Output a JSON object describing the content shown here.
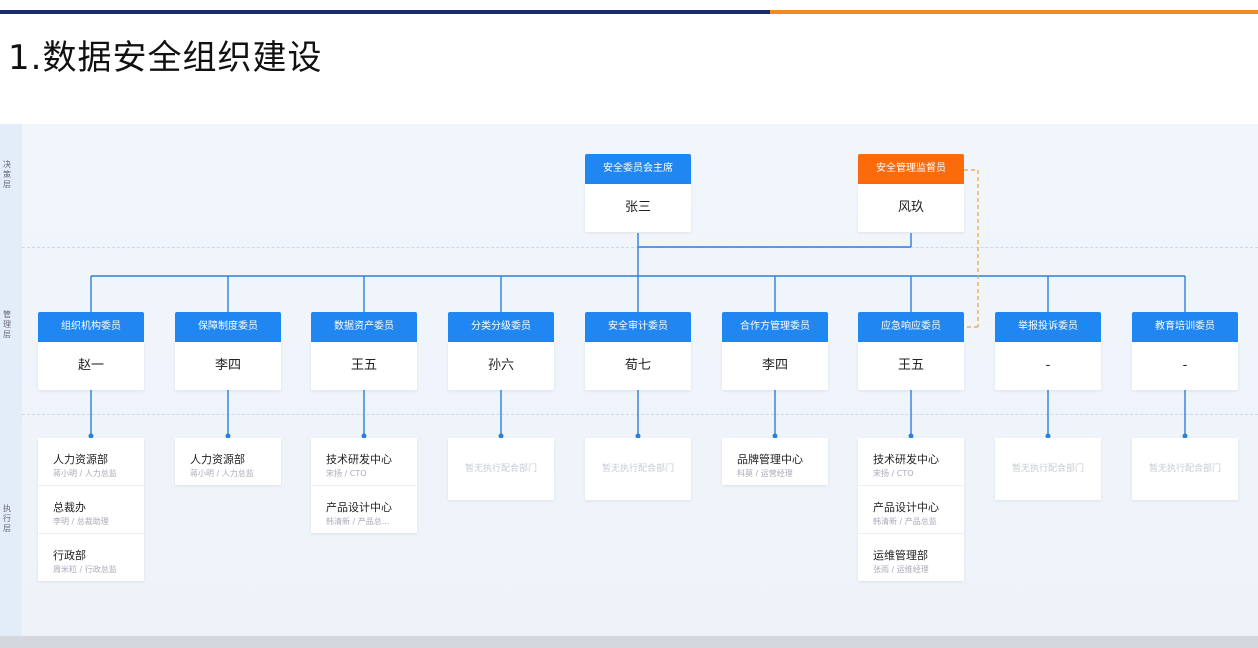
{
  "slide": {
    "title": "1.数据安全组织建设"
  },
  "sidebar": {
    "labels": [
      "决策层",
      "管理层",
      "执行层"
    ]
  },
  "colors": {
    "accent_blue": "#1f86f2",
    "accent_orange": "#fb6a0b",
    "title_bar_blue": "#1a2a6c",
    "title_bar_orange": "#f08a24"
  },
  "top": {
    "chair": {
      "title": "安全委员会主席",
      "name": "张三"
    },
    "supervisor": {
      "title": "安全管理监督员",
      "name": "风玖"
    }
  },
  "committees": [
    {
      "title": "组织机构委员",
      "name": "赵一"
    },
    {
      "title": "保障制度委员",
      "name": "李四"
    },
    {
      "title": "数据资产委员",
      "name": "王五"
    },
    {
      "title": "分类分级委员",
      "name": "孙六"
    },
    {
      "title": "安全审计委员",
      "name": "荀七"
    },
    {
      "title": "合作方管理委员",
      "name": "李四"
    },
    {
      "title": "应急响应委员",
      "name": "王五"
    },
    {
      "title": "举报投诉委员",
      "name": "-"
    },
    {
      "title": "教育培训委员",
      "name": "-"
    }
  ],
  "departments": [
    {
      "items": [
        {
          "name": "人力资源部",
          "sub": "蒋小明 / 人力总监"
        },
        {
          "name": "总裁办",
          "sub": "李明 / 总裁助理"
        },
        {
          "name": "行政部",
          "sub": "周米粒 / 行政总监"
        }
      ]
    },
    {
      "items": [
        {
          "name": "人力资源部",
          "sub": "蒋小明 / 人力总监"
        }
      ]
    },
    {
      "items": [
        {
          "name": "技术研发中心",
          "sub": "宋扬 / CTO"
        },
        {
          "name": "产品设计中心",
          "sub": "韩清新 / 产品总..."
        }
      ]
    },
    {
      "empty": "暂无执行配合部门"
    },
    {
      "empty": "暂无执行配合部门"
    },
    {
      "items": [
        {
          "name": "品牌管理中心",
          "sub": "科莫 / 运营经理"
        }
      ]
    },
    {
      "items": [
        {
          "name": "技术研发中心",
          "sub": "宋扬 / CTO"
        },
        {
          "name": "产品设计中心",
          "sub": "韩清新 / 产品总监"
        },
        {
          "name": "运维管理部",
          "sub": "张雨 / 运维经理"
        }
      ]
    },
    {
      "empty": "暂无执行配合部门"
    },
    {
      "empty": "暂无执行配合部门"
    }
  ]
}
